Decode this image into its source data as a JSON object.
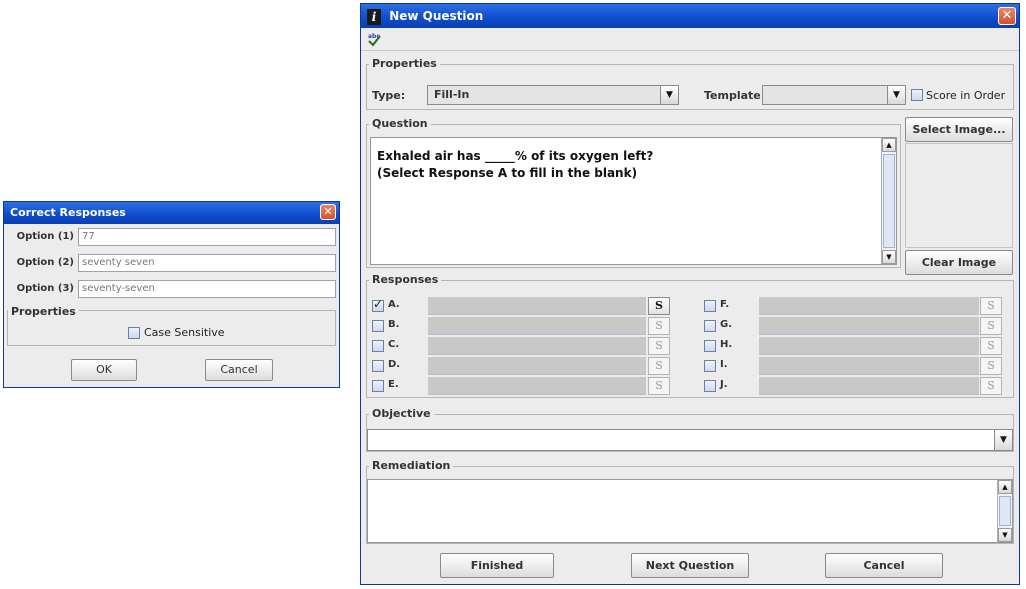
{
  "correct_responses": {
    "title": "Correct Responses",
    "close_glyph": "✕",
    "options": [
      {
        "label": "Option (1)",
        "value": "77"
      },
      {
        "label": "Option (2)",
        "value": "seventy seven"
      },
      {
        "label": "Option (3)",
        "value": "seventy-seven"
      }
    ],
    "properties_title": "Properties",
    "case_sensitive_label": "Case Sensitive",
    "case_sensitive_checked": false,
    "ok_label": "OK",
    "cancel_label": "Cancel"
  },
  "new_question": {
    "title": "New Question",
    "title_icon": "i",
    "close_glyph": "✕",
    "toolbar_icon": "spell-check-icon",
    "properties": {
      "title": "Properties",
      "type_label": "Type:",
      "type_value": "Fill-In",
      "template_label": "Template:",
      "template_value": "",
      "score_in_order_label": "Score in Order",
      "score_in_order_checked": false
    },
    "question": {
      "title": "Question",
      "text_line1": "Exhaled air has _____% of its oxygen left?",
      "text_line2": "(Select Response A to fill in the blank)",
      "select_image_label": "Select Image...",
      "clear_image_label": "Clear Image"
    },
    "responses": {
      "title": "Responses",
      "left": [
        {
          "letter": "A.",
          "checked": true,
          "s_label": "S",
          "active": true
        },
        {
          "letter": "B.",
          "checked": false,
          "s_label": "S",
          "active": false
        },
        {
          "letter": "C.",
          "checked": false,
          "s_label": "S",
          "active": false
        },
        {
          "letter": "D.",
          "checked": false,
          "s_label": "S",
          "active": false
        },
        {
          "letter": "E.",
          "checked": false,
          "s_label": "S",
          "active": false
        }
      ],
      "right": [
        {
          "letter": "F.",
          "checked": false,
          "s_label": "S",
          "active": false
        },
        {
          "letter": "G.",
          "checked": false,
          "s_label": "S",
          "active": false
        },
        {
          "letter": "H.",
          "checked": false,
          "s_label": "S",
          "active": false
        },
        {
          "letter": "I.",
          "checked": false,
          "s_label": "S",
          "active": false
        },
        {
          "letter": "J.",
          "checked": false,
          "s_label": "S",
          "active": false
        }
      ]
    },
    "objective": {
      "title": "Objective",
      "value": ""
    },
    "remediation": {
      "title": "Remediation",
      "value": ""
    },
    "finished_label": "Finished",
    "next_question_label": "Next Question",
    "cancel_label": "Cancel"
  }
}
